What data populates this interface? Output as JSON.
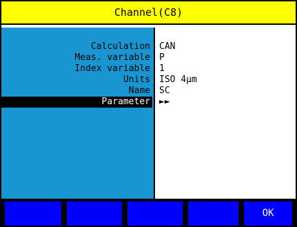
{
  "title": "Channel(C8)",
  "rows": [
    {
      "label": "Calculation",
      "value": "CAN"
    },
    {
      "label": "Meas. variable",
      "value": "P"
    },
    {
      "label": "Index variable",
      "value": "1"
    },
    {
      "label": "Units",
      "value": "ISO 4µm"
    },
    {
      "label": "Name",
      "value": "SC"
    },
    {
      "label": "Parameter",
      "value": "►►"
    }
  ],
  "softkeys": [
    "",
    "",
    "",
    "",
    "OK"
  ],
  "colors": {
    "title_bg": "#ffff00",
    "left_panel_bg": "#1996d2",
    "softkey_bg": "#0000ff",
    "selected_bg": "#000000"
  }
}
